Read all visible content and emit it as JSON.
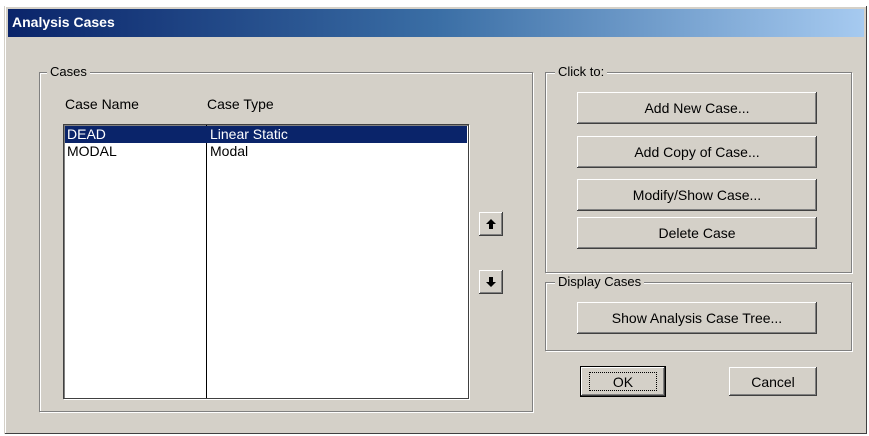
{
  "window": {
    "title": "Analysis Cases"
  },
  "cases_group": {
    "label": "Cases",
    "columns": [
      "Case Name",
      "Case Type"
    ],
    "rows": [
      {
        "name": "DEAD",
        "type": "Linear Static",
        "selected": true
      },
      {
        "name": "MODAL",
        "type": "Modal",
        "selected": false
      }
    ]
  },
  "click_group": {
    "label": "Click to:",
    "buttons": [
      "Add New Case...",
      "Add Copy of Case...",
      "Modify/Show Case...",
      "Delete Case"
    ]
  },
  "display_group": {
    "label": "Display Cases",
    "button": "Show Analysis Case Tree..."
  },
  "footer": {
    "ok": "OK",
    "cancel": "Cancel"
  },
  "colors": {
    "title_start": "#0a246a",
    "title_end": "#a6caf0",
    "selection": "#0a246a",
    "face": "#d4d0c8"
  }
}
